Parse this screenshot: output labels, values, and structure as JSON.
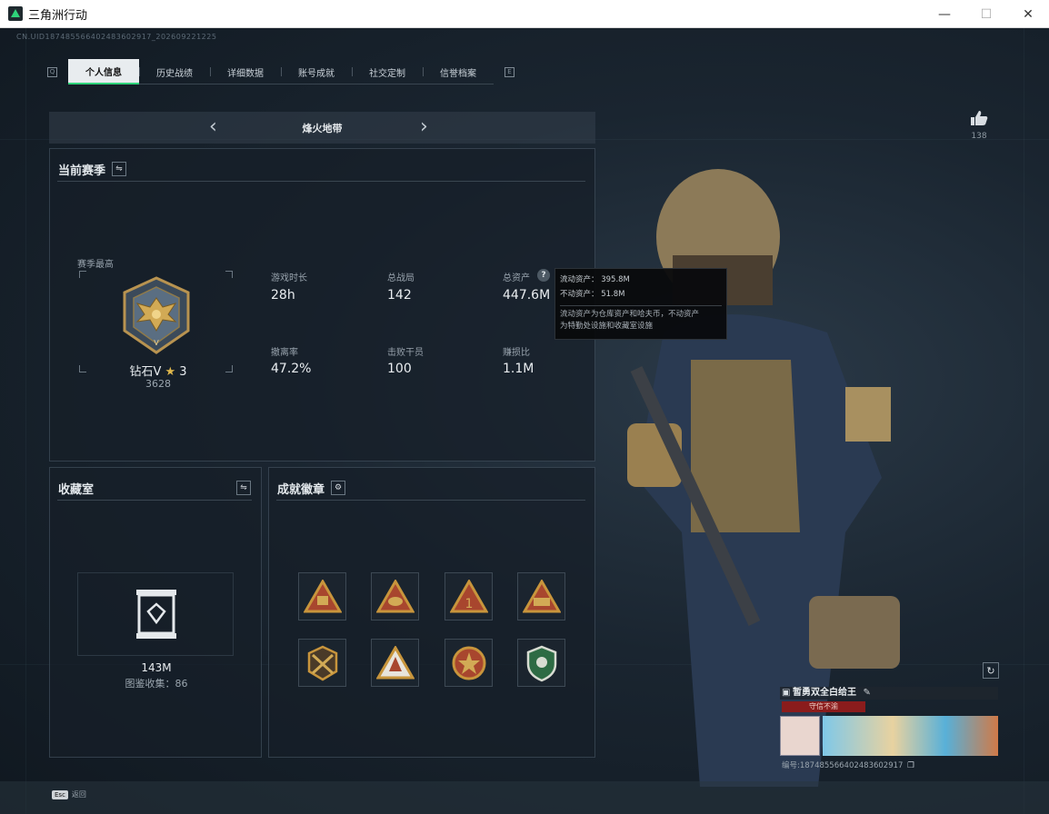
{
  "window": {
    "title": "三角洲行动",
    "minimize": "—",
    "maximize": "☐",
    "close": "✕"
  },
  "header": {
    "uid": "CN.UID1874855664024836029​17_202609221225"
  },
  "tabs": [
    {
      "label": "个人信息",
      "active": true
    },
    {
      "label": "历史战绩",
      "active": false
    },
    {
      "label": "详细数据",
      "active": false
    },
    {
      "label": "账号成就",
      "active": false
    },
    {
      "label": "社交定制",
      "active": false
    },
    {
      "label": "信誉档案",
      "active": false
    }
  ],
  "tab_nav": {
    "left": "Q",
    "right": "E"
  },
  "mode": {
    "name": "烽火地带",
    "prev": "‹",
    "next": "›"
  },
  "season": {
    "title": "当前赛季",
    "switch_icon": "⇋",
    "rank_caption": "赛季最高",
    "rank_name": "钻石V",
    "rank_star": "★",
    "rank_stars": "3",
    "rank_points": "3628",
    "stats": [
      {
        "label": "游戏时长",
        "value": "28h"
      },
      {
        "label": "总战局",
        "value": "142"
      },
      {
        "label": "总资产",
        "value": "447.6M"
      },
      {
        "label": "撤离率",
        "value": "47.2%"
      },
      {
        "label": "击败干员",
        "value": "100"
      },
      {
        "label": "赚损比",
        "value": "1.1M"
      }
    ]
  },
  "tooltip": {
    "liquid_label": "流动资产：",
    "liquid_value": "395.8M",
    "fixed_label": "不动资产：",
    "fixed_value": "51.8M",
    "desc_line1": "流动资产为仓库资产和哈夫币，不动资产",
    "desc_line2": "为特勤处设施和收藏室设施"
  },
  "collection": {
    "title": "收藏室",
    "switch_icon": "⇋",
    "value": "143M",
    "count_text": "图鉴收集：86"
  },
  "achievements": {
    "title": "成就徽章",
    "gear_icon": "⚙"
  },
  "like": {
    "count": "138"
  },
  "profile_card": {
    "name": "暂勇双全白给王",
    "tag": "守信不渝",
    "id_text": "编号:18748556640248360291​7"
  },
  "footer": {
    "esc_key": "Esc",
    "esc_label": "返回"
  },
  "colors": {
    "accent_green": "#2fd37a",
    "tag_red": "#8a1c1c",
    "medal_gold": "#c8953c",
    "medal_red": "#a8462e"
  }
}
